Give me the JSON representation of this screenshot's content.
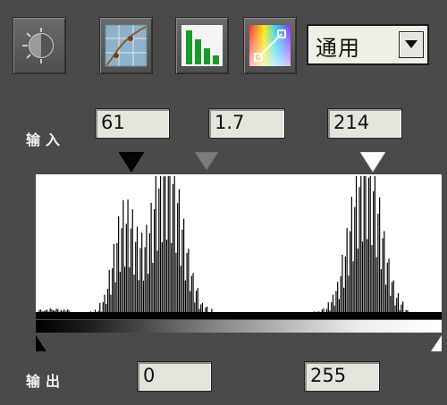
{
  "toolbar": {
    "buttons": [
      {
        "name": "brightness-contrast",
        "icon": "brightness-contrast-icon"
      },
      {
        "name": "curves",
        "icon": "curves-icon"
      },
      {
        "name": "levels",
        "icon": "histogram-icon"
      },
      {
        "name": "color-balance",
        "icon": "color-gradient-icon"
      }
    ],
    "preset": {
      "value": "通用"
    }
  },
  "input": {
    "label": "输入",
    "black": "61",
    "gamma": "1.7",
    "white": "214"
  },
  "output": {
    "label": "输出",
    "black": "0",
    "white": "255"
  },
  "histogram": {
    "bins": 256,
    "peaks": [
      {
        "center": 55,
        "height": 0.62,
        "width": 10
      },
      {
        "center": 82,
        "height": 0.98,
        "width": 14
      },
      {
        "center": 210,
        "height": 0.98,
        "width": 14
      }
    ]
  },
  "colors": {
    "background": "#4a4a4a",
    "field": "#e4e3dc",
    "histogram_bg": "#ffffff",
    "histogram_fg": "#000000"
  }
}
